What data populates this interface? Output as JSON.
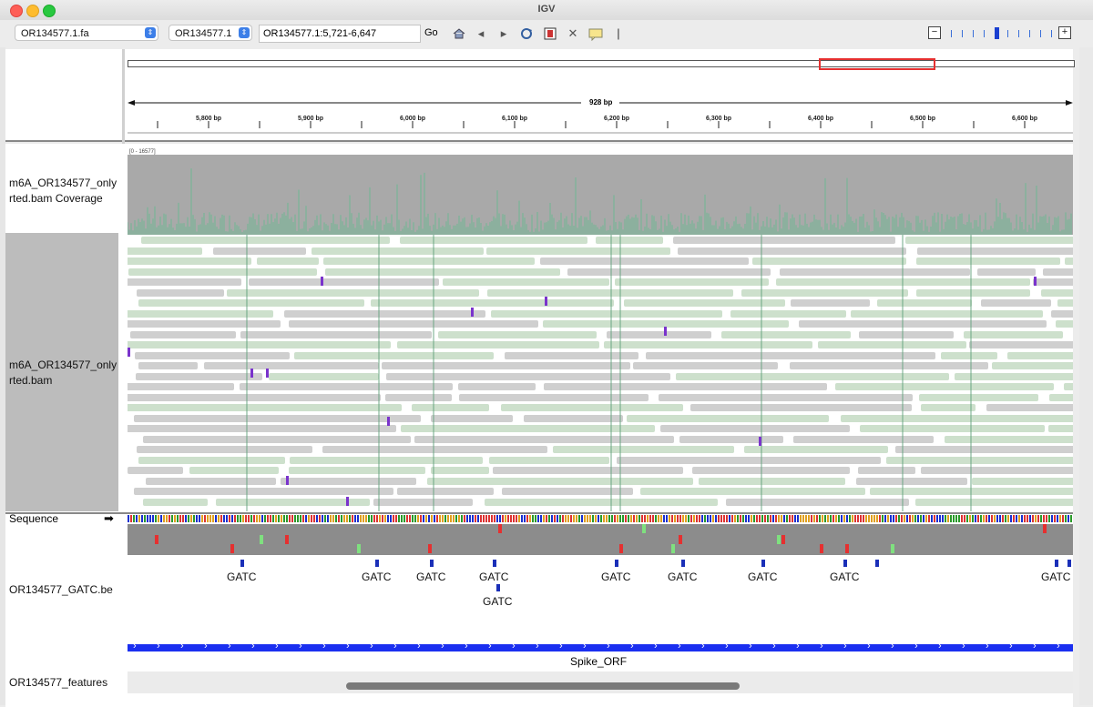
{
  "window": {
    "title": "IGV"
  },
  "toolbar": {
    "genome_value": "OR134577.1.fa",
    "chromosome_value": "OR134577.1",
    "locus_value": "OR134577.1:5,721-6,647",
    "go_label": "Go",
    "icons": [
      "home-icon",
      "back-icon",
      "forward-icon",
      "refresh-icon",
      "roi-icon",
      "resize-icon",
      "popup-info-icon"
    ],
    "zoom_out_label": "−",
    "zoom_in_label": "+"
  },
  "ruler": {
    "span_label": "928 bp",
    "ticks": [
      "5,800 bp",
      "5,900 bp",
      "6,000 bp",
      "6,100 bp",
      "6,200 bp",
      "6,300 bp",
      "6,400 bp",
      "6,500 bp",
      "6,600 bp"
    ]
  },
  "tracks": {
    "coverage_name": "m6A_OR134577_only\nrted.bam Coverage",
    "coverage_range": "[0 - 16577]",
    "alignment_name": "m6A_OR134577_only\nrted.bam",
    "sequence_name": "Sequence",
    "sequence_arrow": "➡",
    "gatc_name": "OR134577_GATC.be",
    "features_name": "OR134577_features"
  },
  "gatc": {
    "label": "GATC",
    "row1": [
      "GATC",
      "GATC",
      "GATC",
      "GATC",
      "GATC",
      "GATC",
      "GATC",
      "GATC",
      "GATC"
    ],
    "row2": [
      "GATC"
    ]
  },
  "features": {
    "spike_label": "Spike_ORF"
  },
  "colors": {
    "coverage_gray": "#a9a9a9",
    "read_gray": "#cfcfcf",
    "read_green": "#cde0cc",
    "roi_red": "#e53030",
    "feature_blue": "#1a2ff0",
    "insertion_purple": "#7a33cc"
  }
}
